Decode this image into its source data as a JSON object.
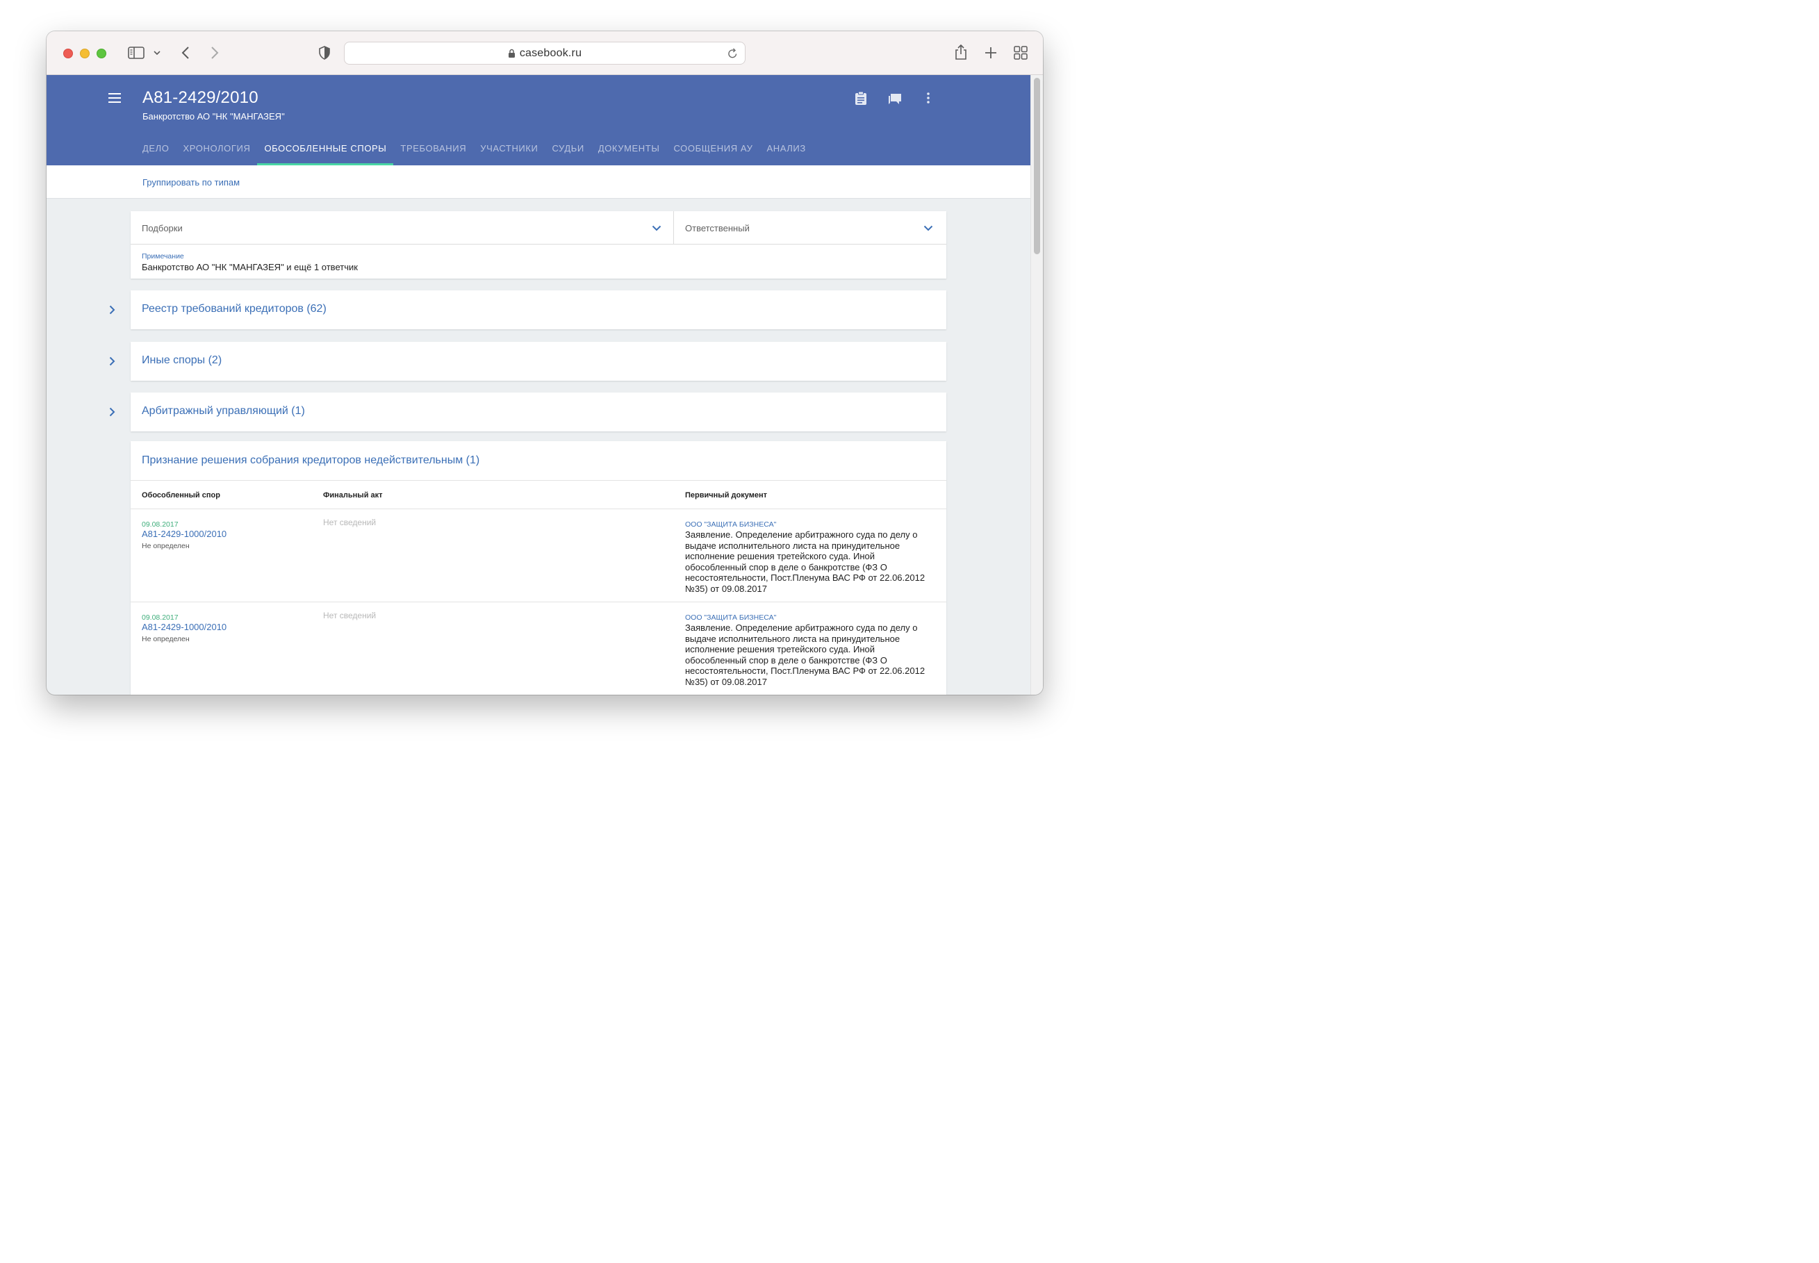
{
  "browser": {
    "url": "casebook.ru"
  },
  "header": {
    "case_number": "А81-2429/2010",
    "subtitle": "Банкротство АО \"НК \"МАНГАЗЕЯ\"",
    "tabs": [
      {
        "label": "ДЕЛО",
        "active": false
      },
      {
        "label": "ХРОНОЛОГИЯ",
        "active": false
      },
      {
        "label": "ОБОСОБЛЕННЫЕ СПОРЫ",
        "active": true
      },
      {
        "label": "ТРЕБОВАНИЯ",
        "active": false
      },
      {
        "label": "УЧАСТНИКИ",
        "active": false
      },
      {
        "label": "СУДЬИ",
        "active": false
      },
      {
        "label": "ДОКУМЕНТЫ",
        "active": false
      },
      {
        "label": "СООБЩЕНИЯ АУ",
        "active": false
      },
      {
        "label": "АНАЛИЗ",
        "active": false
      }
    ],
    "icons": [
      "clipboard-icon",
      "chat-icon",
      "more-vert-icon"
    ]
  },
  "subbar": {
    "group_link": "Группировать по типам"
  },
  "filters": {
    "collections_placeholder": "Подборки",
    "responsible_placeholder": "Ответственный",
    "note_label": "Примечание",
    "note_text": "Банкротство АО \"НК \"МАНГАЗЕЯ\" и ещё 1 ответчик"
  },
  "groups": [
    {
      "title": "Реестр требований кредиторов (62)"
    },
    {
      "title": "Иные споры (2)"
    },
    {
      "title": "Арбитражный управляющий (1)"
    }
  ],
  "table": {
    "title": "Признание решения собрания кредиторов недействительным (1)",
    "columns": [
      "Обособленный спор",
      "Финальный акт",
      "Первичный документ"
    ],
    "rows": [
      {
        "date": "09.08.2017",
        "case": "А81-2429-1000/2010",
        "status": "Не определен",
        "final_act": "Нет сведений",
        "org": "ООО \"ЗАЩИТА БИЗНЕСА\"",
        "document": "Заявление. Определение арбитражного суда по делу о выдаче исполнительного листа на принудительное исполнение решения третейского суда. Иной обособленный спор в деле о банкротстве (ФЗ О несостоятельности, Пост.Пленума ВАС РФ от 22.06.2012 №35) от 09.08.2017"
      },
      {
        "date": "09.08.2017",
        "case": "А81-2429-1000/2010",
        "status": "Не определен",
        "final_act": "Нет сведений",
        "org": "ООО \"ЗАЩИТА БИЗНЕСА\"",
        "document": "Заявление. Определение арбитражного суда по делу о выдаче исполнительного листа на принудительное исполнение решения третейского суда. Иной обособленный спор в деле о банкротстве (ФЗ О несостоятельности, Пост.Пленума ВАС РФ от 22.06.2012 №35) от 09.08.2017"
      }
    ]
  },
  "colors": {
    "header_bg": "#4e6aae",
    "tab_indicator": "#49d6a4",
    "link": "#3b6fb6",
    "date": "#3fae7b"
  }
}
